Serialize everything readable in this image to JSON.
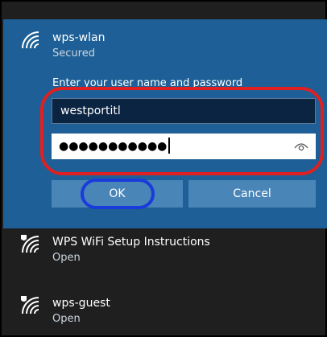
{
  "selected_network": {
    "name": "wps-wlan",
    "status": "Secured",
    "prompt": "Enter your user name and password",
    "username_value": "westportitl",
    "password_mask": "●●●●●●●●●●●",
    "ok_label": "OK",
    "cancel_label": "Cancel"
  },
  "networks": [
    {
      "name": "WPS WiFi Setup Instructions",
      "status": "Open",
      "icon": "wifi-shield-icon"
    },
    {
      "name": "wps-guest",
      "status": "Open",
      "icon": "wifi-shield-icon"
    }
  ],
  "colors": {
    "panel_bg": "#1d5f96",
    "background": "#1f1f1f",
    "button_bg": "#4a85b8",
    "highlight_red": "#e02020",
    "highlight_blue": "#1a3bdc"
  }
}
